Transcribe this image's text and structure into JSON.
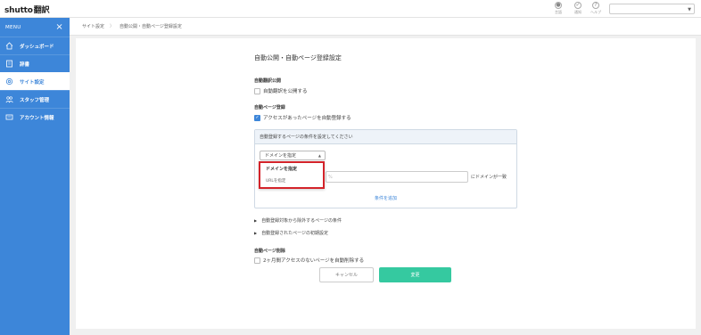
{
  "app": {
    "logo_prefix": "shutto",
    "logo_suffix": "翻訳"
  },
  "header": {
    "icons": [
      {
        "name": "globe-icon",
        "label": "言語"
      },
      {
        "name": "bell-icon",
        "label": "通知"
      },
      {
        "name": "help-icon",
        "label": "ヘルプ"
      }
    ],
    "site_select_value": ""
  },
  "sidebar": {
    "menu_label": "MENU",
    "items": [
      {
        "label": "ダッシュボード",
        "icon": "home-icon"
      },
      {
        "label": "辞書",
        "icon": "book-icon"
      },
      {
        "label": "サイト設定",
        "icon": "gear-icon",
        "active": true
      },
      {
        "label": "スタッフ管理",
        "icon": "staff-icon"
      },
      {
        "label": "アカウント情報",
        "icon": "account-icon"
      }
    ]
  },
  "breadcrumb": {
    "items": [
      "サイト設定",
      "自動公開・自動ページ登録設定"
    ]
  },
  "main": {
    "title": "自動公開・自動ページ登録設定",
    "auto_translate": {
      "heading": "自動翻訳公開",
      "checkbox_label": "自動翻訳を公開する",
      "checked": false
    },
    "auto_page": {
      "heading": "自動ページ登録",
      "checkbox_label": "アクセスがあったページを自動登録する",
      "checked": true
    },
    "condition_box": {
      "header": "自動登録するページの条件を設定してください",
      "dropdown_value": "ドメインを指定",
      "dropdown_options": [
        "ドメインを指定",
        "URLを指定"
      ],
      "input_placeholder": "%",
      "suffix": "にドメインが一致",
      "add_link": "条件を追加"
    },
    "expanders": [
      "自動登録対象から除外するページの条件",
      "自動登録されたページの初期設定"
    ],
    "auto_delete": {
      "heading": "自動ページ削除",
      "checkbox_label": "2ヶ月間アクセスのないページを自動削除する",
      "checked": false
    },
    "buttons": {
      "cancel": "キャンセル",
      "save": "変更"
    }
  },
  "colors": {
    "sidebar": "#3d86d9",
    "save": "#35c9a0",
    "highlight": "#d3232a"
  }
}
